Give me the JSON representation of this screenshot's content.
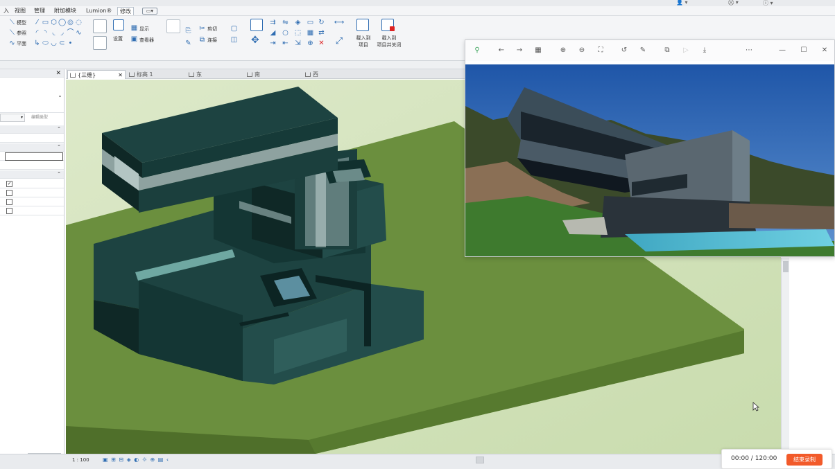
{
  "ribbon": {
    "menus": [
      "入",
      "视图",
      "管理",
      "附加模块",
      "Lumion®",
      "修改"
    ],
    "active_menu": "修改",
    "draw_tools": [
      "模型",
      "参照",
      "平面"
    ],
    "display_labels": [
      "显示",
      "查看器"
    ],
    "setting_label": "设置",
    "edit_tools": [
      "剪切",
      "连接"
    ],
    "load_into_project": "载入到\n项目",
    "load_into_project_close": "载入到\n项目并关闭"
  },
  "left_panel": {
    "apply_label": "应用",
    "edit_type_label": "编辑类型",
    "checkboxes": [
      true,
      false,
      false,
      false
    ]
  },
  "view_tabs": [
    {
      "label": "{三维}",
      "active": true
    },
    {
      "label": "标高 1",
      "active": false
    },
    {
      "label": "东",
      "active": false
    },
    {
      "label": "南",
      "active": false
    },
    {
      "label": "西",
      "active": false
    }
  ],
  "status_bar": {
    "scale": "1 : 100"
  },
  "recording": {
    "time": "00:00 / 120:00",
    "stop_label": "结束录制"
  },
  "colors": {
    "ground_top": "#6b8f3e",
    "ground_side": "#577a2f",
    "building": "#1a3a38",
    "accent_record": "#f25a2a"
  }
}
